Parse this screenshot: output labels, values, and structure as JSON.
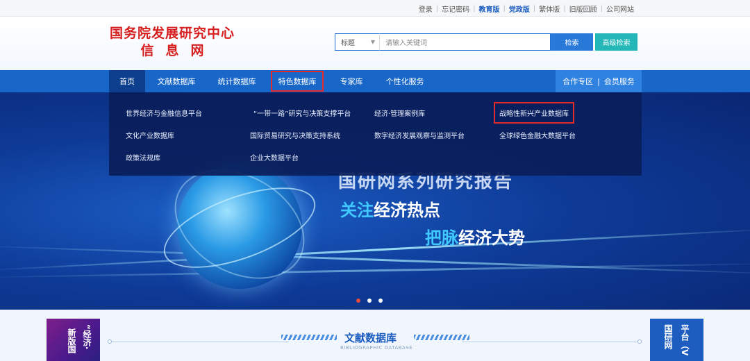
{
  "top_links": [
    {
      "label": "登录",
      "highlight": false
    },
    {
      "label": "忘记密码",
      "highlight": false
    },
    {
      "label": "教育版",
      "highlight": true
    },
    {
      "label": "党政版",
      "highlight": true
    },
    {
      "label": "繁体版",
      "highlight": false
    },
    {
      "label": "旧版回顾",
      "highlight": false
    },
    {
      "label": "公司网站",
      "highlight": false
    }
  ],
  "logo": {
    "line1": "国务院发展研究中心",
    "line2": "信息网"
  },
  "search": {
    "type_value": "标题",
    "placeholder": "请输入关键词",
    "button": "检索",
    "advanced": "高级检索"
  },
  "nav": {
    "items": [
      "首页",
      "文献数据库",
      "统计数据库",
      "特色数据库",
      "专家库",
      "个性化服务"
    ],
    "right_a": "合作专区",
    "right_sep": "|",
    "right_b": "会员服务"
  },
  "dropdown": {
    "items": [
      "世界经济与金融信息平台",
      "“一带一路”研究与决策支撑平台",
      "经济·管理案例库",
      "战略性新兴产业数据库",
      "文化产业数据库",
      "国际贸易研究与决策支持系统",
      "数字经济发展观察与监测平台",
      "全球绿色金融大数据平台",
      "政策法规库",
      "企业大数据平台"
    ]
  },
  "banner": {
    "title": "国研网系列研究报告",
    "line1_hl": "关注",
    "line1_rest": "经济热点",
    "line2_hl": "把脉",
    "line2_rest": "经济大势"
  },
  "section": {
    "title": "文献数据库",
    "subtitle": "BIBLIOGRAPHIC DATABASE"
  },
  "left_card": {
    "col1": "“经济·",
    "col2": "新版国"
  },
  "right_card": {
    "col1": "平台（V",
    "col2": "国研网"
  },
  "colors": {
    "nav": "#1766c8",
    "nav_active": "#0d3f8f",
    "accent_red": "#e22a2a",
    "search_blue": "#2979d9",
    "teal": "#24b7b7"
  }
}
